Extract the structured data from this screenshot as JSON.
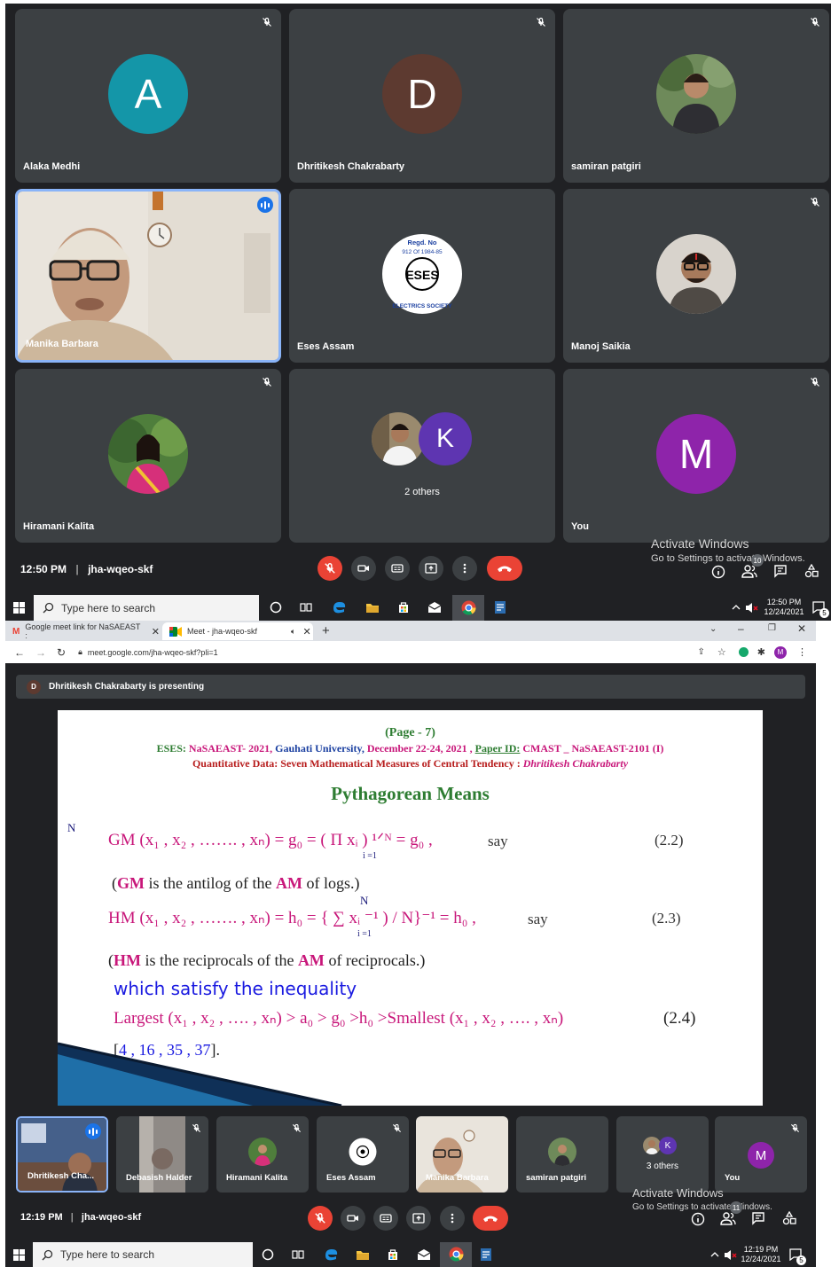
{
  "top_meet": {
    "tiles": [
      {
        "name": "Alaka Medhi",
        "initial": "A",
        "color": "#1496a8",
        "muted": true
      },
      {
        "name": "Dhritikesh Chakrabarty",
        "initial": "D",
        "color": "#5d3a30",
        "muted": true
      },
      {
        "name": "samiran patgiri",
        "muted": true
      },
      {
        "name": "Manika Barbara",
        "speaking": true
      },
      {
        "name": "Eses Assam"
      },
      {
        "name": "Manoj Saikia",
        "muted": true
      },
      {
        "name": "Hiramani Kalita",
        "muted": true
      },
      {
        "name": "2 others",
        "initial": "K"
      },
      {
        "name": "You",
        "initial": "M",
        "color": "#8e24aa",
        "muted": true
      }
    ],
    "logo_text": {
      "regd": "Regd. No",
      "num": "912 Of 1984-85",
      "ring": "ELECTRICS SOCIETY",
      "mono": "ESES"
    },
    "time": "12:50 PM",
    "code": "jha-wqeo-skf",
    "sep": "|",
    "badges": {
      "people": "10"
    },
    "watermark_title": "Activate Windows",
    "watermark_sub": "Go to Settings to activate Windows.",
    "taskbar": {
      "search": "Type here to search",
      "time": "12:50 PM",
      "date": "12/24/2021",
      "notif": "5"
    }
  },
  "browser": {
    "tab1": "Google meet link for NaSAEAST :",
    "tab2": "Meet - jha-wqeo-skf",
    "url": "meet.google.com/jha-wqeo-skf?pli=1",
    "presenting": "Dhritikesh Chakrabarty is presenting",
    "presenter_initial": "D",
    "profile": "M"
  },
  "slide": {
    "page": "(Page - 7)",
    "line1_a": "ESES:",
    "line1_b": "NaSAEAST- 2021,",
    "line1_c": "Gauhati University,",
    "line1_d": "December 22-24, 2021 ,",
    "line1_e": "Paper ID:",
    "line1_f": "CMAST _ NaSAEAST-2101 (I)",
    "line2_a": "Quantitative Data: Seven Mathematical Measures of Central Tendency :",
    "line2_b": "Dhritikesh Chakrabarty",
    "title": "Pythagorean Means",
    "gm": "GM (x₁ , x₂ , ……. , xₙ)  =  g₀  =  (  Π  xᵢ ) ¹ᐟᴺ =  g₀  ,",
    "gm_say": "say",
    "eq1": "(2.2)",
    "gm_N": "N",
    "gm_i": "i =1",
    "note1_a": "(",
    "note1_gm": "GM",
    "note1_b": " is the antilog of the ",
    "note1_am": "AM",
    "note1_c": " of  logs.)",
    "hm": "HM (x₁ , x₂ , ……. , xₙ)  = h₀  =  { ∑  xᵢ ⁻¹ ) / N}⁻¹ = h₀  ,",
    "hm_say": "say",
    "eq2": "(2.3)",
    "hm_N": "N",
    "hm_i": "i =1",
    "note2_a": "(",
    "note2_hm": "HM",
    "note2_b": " is the reciprocals of the ",
    "note2_am": "AM",
    "note2_c": " of  reciprocals.)",
    "satisfy": "which satisfy the inequality",
    "ineq": "Largest (x₁ , x₂ , …. , xₙ) > a₀ > g₀ >h₀ >Smallest (x₁ , x₂ , …. , xₙ)",
    "eq3": "(2.4)",
    "cite_a": "[",
    "cite_b": "4 , 16 , 35 , 37",
    "cite_c": "]."
  },
  "bottom_meet": {
    "strip": [
      {
        "name": "Dhritikesh Cha...",
        "speaking": true
      },
      {
        "name": "Debasish Halder",
        "muted": true
      },
      {
        "name": "Hiramani Kalita",
        "muted": true
      },
      {
        "name": "Eses Assam",
        "muted": true
      },
      {
        "name": "Manika Barbara"
      },
      {
        "name": "samiran patgiri"
      },
      {
        "name": "3 others",
        "initial": "K"
      },
      {
        "name": "You",
        "initial": "M",
        "muted": true
      }
    ],
    "time": "12:19 PM",
    "code": "jha-wqeo-skf",
    "sep": "|",
    "badges": {
      "people": "11"
    },
    "watermark_title": "Activate Windows",
    "watermark_sub": "Go to Settings to activate Windows.",
    "taskbar": {
      "search": "Type here to search",
      "time": "12:19 PM",
      "date": "12/24/2021",
      "notif": "5"
    }
  }
}
